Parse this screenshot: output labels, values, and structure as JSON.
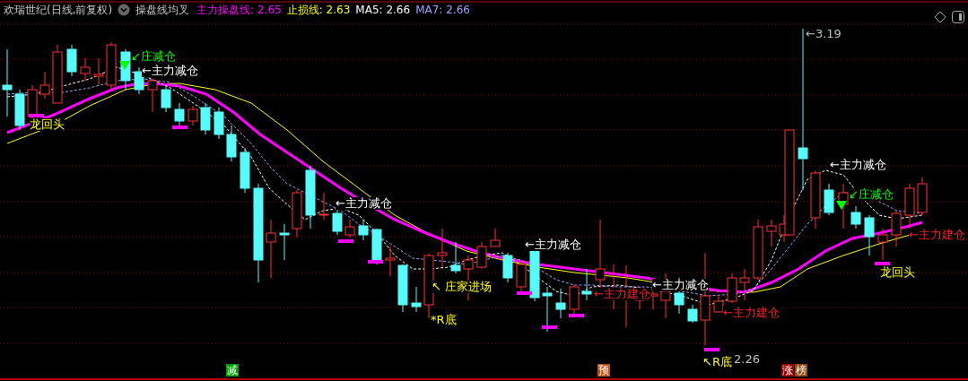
{
  "header": {
    "title": "欢瑞世纪(日线,前复权)",
    "indicator": "操盘线均叉",
    "legend": [
      {
        "label": "主力操盘线: 2.65",
        "color": "#ff00ff"
      },
      {
        "label": "止损线: 2.63",
        "color": "#ffff00"
      },
      {
        "label": "MA5: 2.66",
        "color": "#ffffff"
      },
      {
        "label": "MA7: 2.66",
        "color": "#a0a0ff"
      }
    ]
  },
  "annotations": [
    {
      "text": "↙庄减仓",
      "color": "#00ff00"
    },
    {
      "text": "←主力减仓",
      "color": "#ffffff"
    },
    {
      "text": "龙回头",
      "color": "#ffff00"
    },
    {
      "text": "←主力减仓",
      "color": "#ffffff"
    },
    {
      "text": "↖ 庄家进场",
      "color": "#ffff00"
    },
    {
      "text": "*R底",
      "color": "#ffff00"
    },
    {
      "text": "←主力减仓",
      "color": "#ffffff"
    },
    {
      "text": "←主力建仓",
      "color": "#ff2020"
    },
    {
      "text": "←主力减仓",
      "color": "#ffffff"
    },
    {
      "text": "←主力建仓",
      "color": "#ff2020"
    },
    {
      "text": "↖R底",
      "color": "#ffff00"
    },
    {
      "text": "2.26",
      "color": "#c0c0c0"
    },
    {
      "text": "←3.19",
      "color": "#c0c0c0"
    },
    {
      "text": "←主力减仓",
      "color": "#ffffff"
    },
    {
      "text": "↙庄减仓",
      "color": "#00ff00"
    },
    {
      "text": "←主力建仓",
      "color": "#ff2020"
    },
    {
      "text": "龙回头",
      "color": "#ffff00"
    }
  ],
  "markers": [
    {
      "label": "减",
      "color": "#00a000"
    },
    {
      "label": "预",
      "color": "#c05010"
    },
    {
      "label": "涨",
      "color": "#a00000"
    },
    {
      "label": "榜",
      "color": "#8a4a10"
    }
  ]
}
